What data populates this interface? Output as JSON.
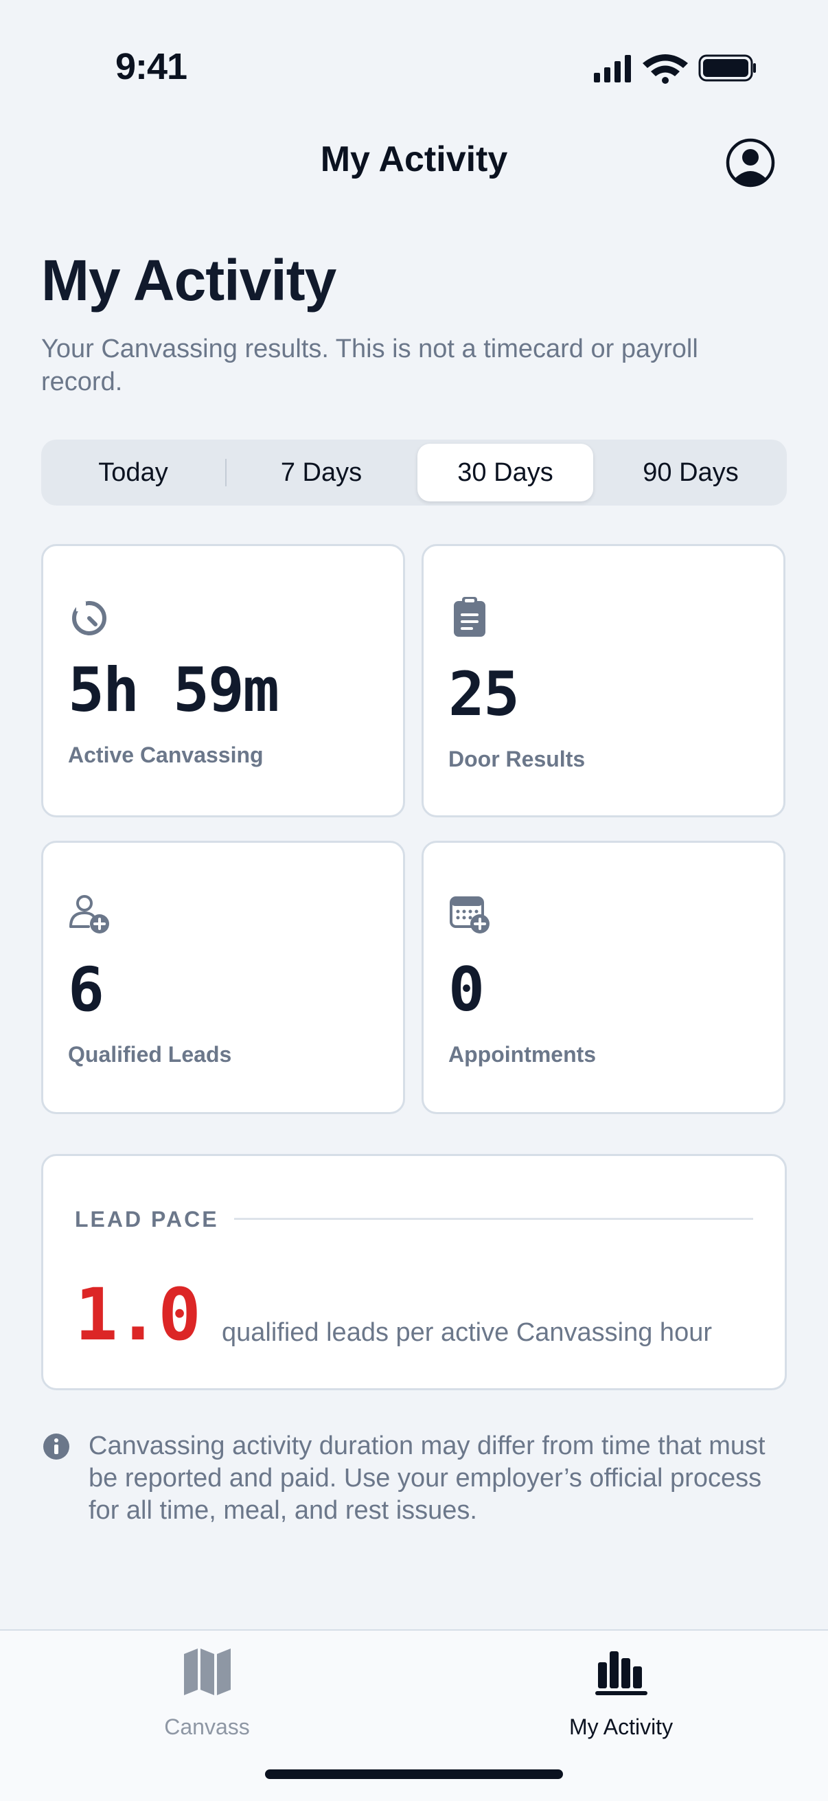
{
  "status_bar": {
    "time": "9:41"
  },
  "nav": {
    "title": "My Activity"
  },
  "header": {
    "title": "My Activity",
    "subtitle": "Your Canvassing results. This is not a timecard or payroll record."
  },
  "range_tabs": {
    "selected": "30 Days",
    "items": [
      {
        "label": "Today"
      },
      {
        "label": "7 Days"
      },
      {
        "label": "30 Days"
      },
      {
        "label": "90 Days"
      }
    ]
  },
  "stats": [
    {
      "icon": "timer-icon",
      "value": "5h 59m",
      "label": "Active Canvassing"
    },
    {
      "icon": "clipboard-icon",
      "value": "25",
      "label": "Door Results"
    },
    {
      "icon": "add-user-icon",
      "value": "6",
      "label": "Qualified Leads"
    },
    {
      "icon": "calendar-add-icon",
      "value": "0",
      "label": "Appointments"
    }
  ],
  "lead_pace": {
    "label": "LEAD PACE",
    "value": "1.0",
    "description": "qualified leads per active Canvassing hour"
  },
  "disclaimer": "Canvassing activity duration may differ from time that must be reported and paid. Use your employer’s official process for all time, meal, and rest issues.",
  "tab_bar": {
    "items": [
      {
        "label": "Canvass",
        "icon": "map-icon",
        "active": false
      },
      {
        "label": "My Activity",
        "icon": "bar-chart-icon",
        "active": true
      }
    ]
  },
  "colors": {
    "accent_red": "#dc2626",
    "text_primary": "#111a2c",
    "text_secondary": "#6b778a",
    "background": "#f1f4f8",
    "tab_inactive": "#8e97a4"
  }
}
